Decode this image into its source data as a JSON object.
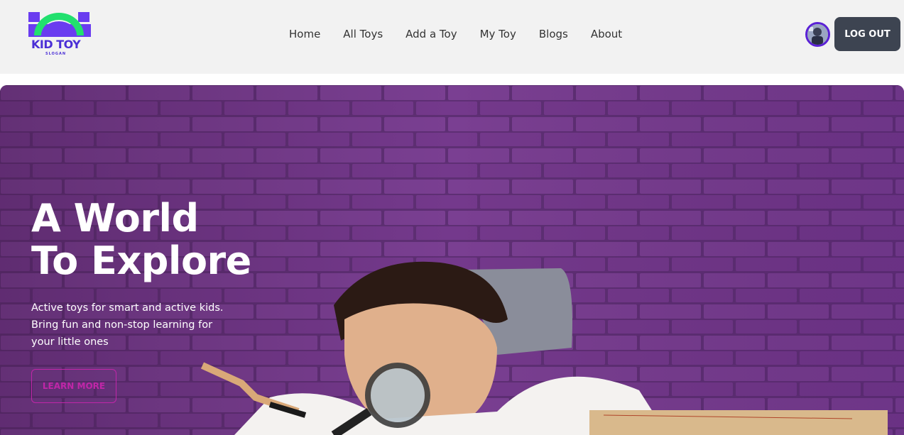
{
  "brand": {
    "name": "KID TOY",
    "slogan": "SLOGAN",
    "colors": {
      "primary": "#4b2fd6",
      "accent": "#22e06e"
    }
  },
  "nav": {
    "items": [
      {
        "label": "Home"
      },
      {
        "label": "All Toys"
      },
      {
        "label": "Add a Toy"
      },
      {
        "label": "My Toy"
      },
      {
        "label": "Blogs"
      },
      {
        "label": "About"
      }
    ]
  },
  "user": {
    "avatar_icon": "user-avatar",
    "logout_label": "LOG OUT"
  },
  "hero": {
    "title_line1": "A World",
    "title_line2": "To Explore",
    "desc_line1": "Active toys for smart and active kids.",
    "desc_line2": "Bring fun and non-stop learning for",
    "desc_line3": "your little ones",
    "cta_label": "LEARN MORE",
    "image": "boy-with-magnifying-glass-photo",
    "colors": {
      "brick": "#6e3a86",
      "cta": "#c026a8"
    }
  }
}
